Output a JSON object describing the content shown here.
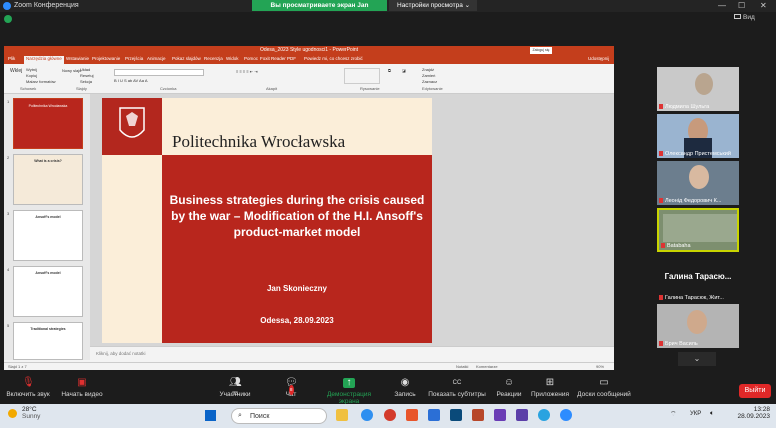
{
  "zoom": {
    "title": "Zoom Конференция",
    "share_banner": "Вы просматриваете экран Jan Skonieczny",
    "share_options": "Настройки просмотра",
    "view_label": "Вид",
    "toolbar": {
      "mute": "Включить звук",
      "video": "Начать видео",
      "participants": "Участники",
      "participants_count": "33",
      "chat": "Чат",
      "chat_badge": "8",
      "share": "Демонстрация экрана",
      "record": "Запись",
      "captions": "Показать субтитры",
      "reactions": "Реакции",
      "apps": "Приложения",
      "whiteboards": "Доски сообщений",
      "leave": "Выйти"
    },
    "participants": [
      {
        "name": "Людмила Шульга",
        "muted": true
      },
      {
        "name": "Олександр Пристемський",
        "muted": true
      },
      {
        "name": "Леонід Федорович К...",
        "muted": true
      },
      {
        "name": "Batabaha",
        "muted": true
      },
      {
        "name": "Галина Тарасюк, Жит...",
        "display": "Галина Тарасю...",
        "muted": true
      },
      {
        "name": "Брич Василь",
        "muted": true
      }
    ]
  },
  "ppt": {
    "window_title": "Odesa_2023 Style ugodnosci1  -  PowerPoint",
    "tabs": [
      "Plik",
      "Narzędzia główne",
      "Wstawianie",
      "Projektowanie",
      "Przejścia",
      "Animacje",
      "Pokaz slajdów",
      "Recenzja",
      "Widok",
      "Pomoc",
      "Foxit Reader PDF",
      "Powiedz mi, co chcesz zrobić"
    ],
    "active_tab": "Narzędzia główne",
    "share_btn": "Udostępnij",
    "ribbon_groups": [
      "Schowek",
      "Slajdy",
      "Czcionka",
      "Akapit",
      "Rysowanie",
      "Edytowanie"
    ],
    "ribbon_buttons": {
      "paste": "Wklej",
      "cut": "Wytnij",
      "copy": "Kopiuj",
      "format": "Malarz formatów",
      "new_slide": "Nowy slajd",
      "layout": "Układ",
      "reset": "Resetuj",
      "section": "Sekcja",
      "find": "Znajdź",
      "replace": "Zamień",
      "select": "Zaznacz"
    },
    "thumbnails": [
      {
        "num": "1",
        "title": "Politechnika Wrocławska"
      },
      {
        "num": "2",
        "title": "What is a crisis?"
      },
      {
        "num": "3",
        "title": "Ansoff's model"
      },
      {
        "num": "4",
        "title": "Ansoff's model"
      },
      {
        "num": "5",
        "title": "Traditional strategies"
      }
    ],
    "slide": {
      "university": "Politechnika Wrocławska",
      "title": "Business strategies during the crisis caused by the war – Modification of the H.I. Ansoff's product-market model",
      "author": "Jan Skonieczny",
      "date": "Odessa, 28.09.2023"
    },
    "notes_placeholder": "Kliknij, aby dodać notatki",
    "status_left": "Slajd 1 z 7",
    "status_notes": "Notatki",
    "status_comments": "Komentarze",
    "zoom_level": "90%"
  },
  "taskbar": {
    "temp": "28°C",
    "weather": "Sunny",
    "search": "Поиск",
    "lang": "УКР",
    "time": "13:28",
    "date": "28.09.2023"
  }
}
